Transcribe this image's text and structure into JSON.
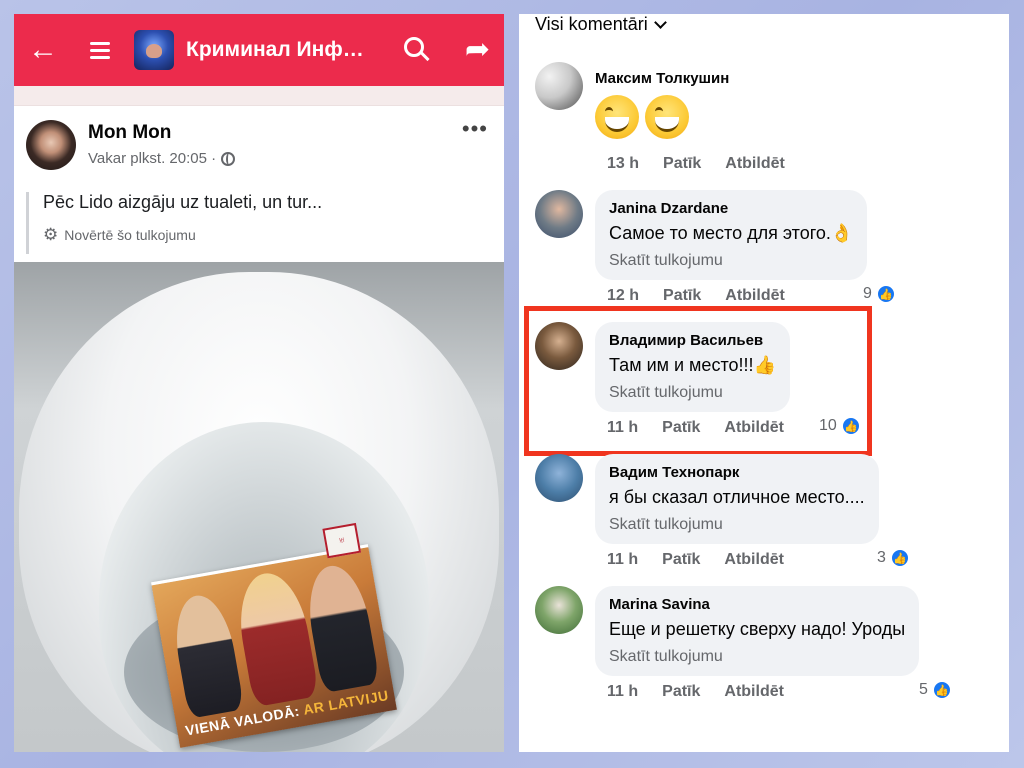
{
  "left": {
    "topbar": {
      "back_icon": "arrow-left-icon",
      "title": "Криминал Инф…",
      "avatar_label": "group-avatar"
    },
    "post": {
      "author": "Mon Mon",
      "time": "Vakar plkst. 20:05 ·",
      "text": "Pēc Lido aizgāju uz tualeti, un tur...",
      "translate_label": "Novērtē šo tulkojumu"
    },
    "photo": {
      "slogan_a": "VIENĀ VALODĀ:",
      "slogan_b": "AR LATVIJU"
    }
  },
  "right": {
    "sort_label": "Visi komentāri",
    "comments": [
      {
        "name": "Максим Толкушин",
        "text": "😄😄",
        "time": "13 h",
        "like": "Patīk",
        "reply": "Atbildēt",
        "count": ""
      },
      {
        "name": "Janina  Dzardane",
        "text": "Самое то место для этого.👌",
        "trans": "Skatīt tulkojumu",
        "time": "12 h",
        "like": "Patīk",
        "reply": "Atbildēt",
        "count": "9"
      },
      {
        "name": "Владимир Васильев",
        "text": "Там им и место!!!👍",
        "trans": "Skatīt tulkojumu",
        "time": "11 h",
        "like": "Patīk",
        "reply": "Atbildēt",
        "count": "10"
      },
      {
        "name": "Вадим Технопарк",
        "text": "я бы сказал отличное место....",
        "trans": "Skatīt tulkojumu",
        "time": "11 h",
        "like": "Patīk",
        "reply": "Atbildēt",
        "count": "3"
      },
      {
        "name": "Marina Savina",
        "text": "Еще и решетку сверху надо! Уроды",
        "trans": "Skatīt tulkojumu",
        "time": "11 h",
        "like": "Patīk",
        "reply": "Atbildēt",
        "count": "5"
      }
    ]
  },
  "colors": {
    "topbar": "#ec2b4c",
    "highlight": "#f0351f",
    "like_blue": "#1877f2"
  }
}
